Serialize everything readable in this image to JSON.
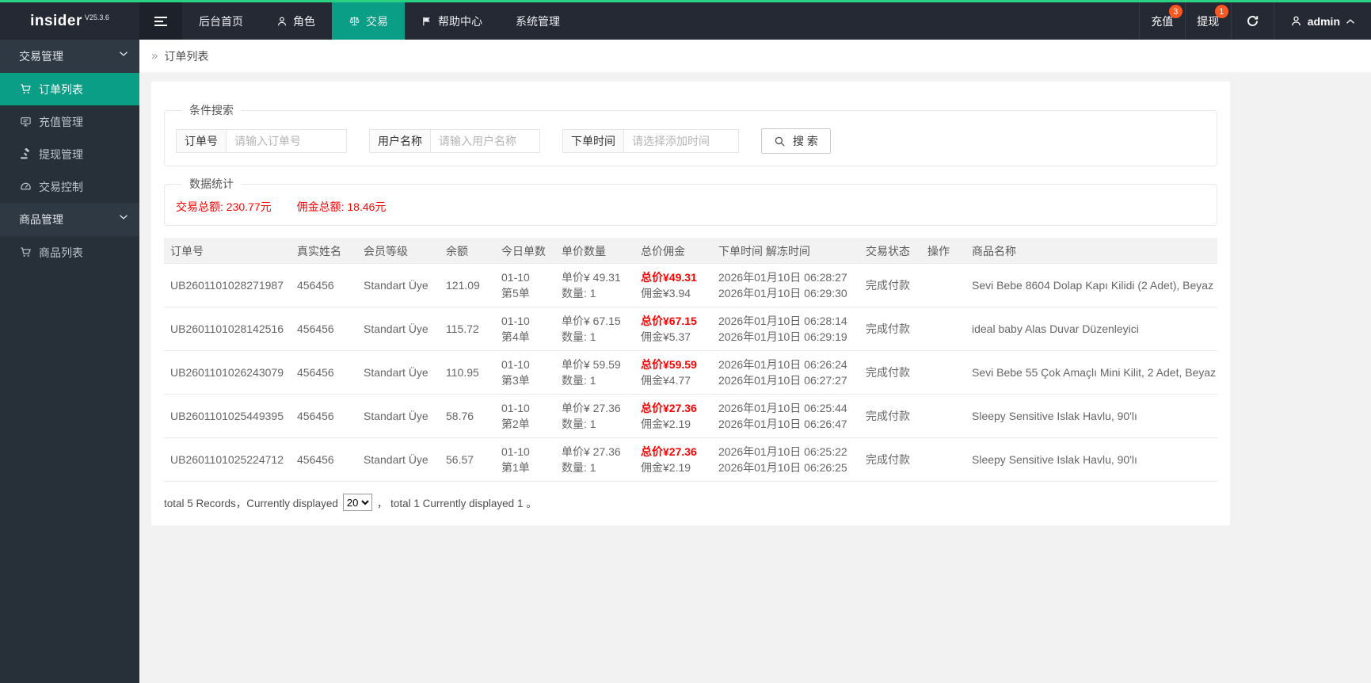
{
  "colors": {
    "accent_green": "#2ad184",
    "teal": "#0a9e86",
    "badge": "#ff5722",
    "red": "#ff0000"
  },
  "header": {
    "logo": "insider",
    "version": "V25.3.6",
    "nav": [
      {
        "label": "后台首页",
        "icon": "",
        "active": false
      },
      {
        "label": "角色",
        "icon": "user-icon",
        "active": false
      },
      {
        "label": "交易",
        "icon": "scales-icon",
        "active": true
      },
      {
        "label": "帮助中心",
        "icon": "flag-icon",
        "active": false
      },
      {
        "label": "系统管理",
        "icon": "",
        "active": false
      }
    ],
    "shortcuts": [
      {
        "label": "充值",
        "badge": "3"
      },
      {
        "label": "提现",
        "badge": "1"
      }
    ],
    "username": "admin"
  },
  "sidebar": {
    "items": [
      {
        "type": "group",
        "label": "交易管理"
      },
      {
        "type": "item",
        "label": "订单列表",
        "icon": "cart-icon",
        "active": true
      },
      {
        "type": "item",
        "label": "充值管理",
        "icon": "card-icon",
        "active": false
      },
      {
        "type": "item",
        "label": "提现管理",
        "icon": "gavel-icon",
        "active": false
      },
      {
        "type": "item",
        "label": "交易控制",
        "icon": "gauge-icon",
        "active": false
      },
      {
        "type": "group",
        "label": "商品管理"
      },
      {
        "type": "item",
        "label": "商品列表",
        "icon": "cart-icon",
        "active": false
      }
    ]
  },
  "breadcrumb": {
    "arrow": "»",
    "label": "订单列表"
  },
  "search_panel": {
    "legend": "条件搜索",
    "fields": [
      {
        "label": "订单号",
        "placeholder": "请输入订单号"
      },
      {
        "label": "用户名称",
        "placeholder": "请输入用户名称"
      },
      {
        "label": "下单时间",
        "placeholder": "请选择添加时间"
      }
    ],
    "search_button": "搜 索"
  },
  "stats_panel": {
    "legend": "数据统计",
    "items": [
      "交易总额: 230.77元",
      "佣金总额: 18.46元"
    ]
  },
  "table": {
    "columns": [
      "订单号",
      "真实姓名",
      "会员等级",
      "余额",
      "今日单数",
      "单价数量",
      "总价佣金",
      "下单时间 解冻时间",
      "交易状态",
      "操作",
      "商品名称"
    ],
    "rows": [
      {
        "order_no": "UB2601101028271987",
        "real_name": "456456",
        "level": "Standart Üye",
        "balance": "121.09",
        "date": "01-10",
        "daily": "第5单",
        "unit_price": "单价¥ 49.31",
        "quantity": "数量: 1",
        "total": "总价¥49.31",
        "commission": "佣金¥3.94",
        "order_time": "2026年01月10日 06:28:27",
        "unfreeze_time": "2026年01月10日 06:29:30",
        "status": "完成付款",
        "action": "",
        "product": "Sevi Bebe 8604 Dolap Kapı Kilidi (2 Adet), Beyaz"
      },
      {
        "order_no": "UB2601101028142516",
        "real_name": "456456",
        "level": "Standart Üye",
        "balance": "115.72",
        "date": "01-10",
        "daily": "第4单",
        "unit_price": "单价¥ 67.15",
        "quantity": "数量: 1",
        "total": "总价¥67.15",
        "commission": "佣金¥5.37",
        "order_time": "2026年01月10日 06:28:14",
        "unfreeze_time": "2026年01月10日 06:29:19",
        "status": "完成付款",
        "action": "",
        "product": "ideal baby Alas Duvar Düzenleyici"
      },
      {
        "order_no": "UB2601101026243079",
        "real_name": "456456",
        "level": "Standart Üye",
        "balance": "110.95",
        "date": "01-10",
        "daily": "第3单",
        "unit_price": "单价¥ 59.59",
        "quantity": "数量: 1",
        "total": "总价¥59.59",
        "commission": "佣金¥4.77",
        "order_time": "2026年01月10日 06:26:24",
        "unfreeze_time": "2026年01月10日 06:27:27",
        "status": "完成付款",
        "action": "",
        "product": "Sevi Bebe 55 Çok Amaçlı Mini Kilit, 2 Adet, Beyaz"
      },
      {
        "order_no": "UB2601101025449395",
        "real_name": "456456",
        "level": "Standart Üye",
        "balance": "58.76",
        "date": "01-10",
        "daily": "第2单",
        "unit_price": "单价¥ 27.36",
        "quantity": "数量: 1",
        "total": "总价¥27.36",
        "commission": "佣金¥2.19",
        "order_time": "2026年01月10日 06:25:44",
        "unfreeze_time": "2026年01月10日 06:26:47",
        "status": "完成付款",
        "action": "",
        "product": "Sleepy Sensitive Islak Havlu, 90'lı"
      },
      {
        "order_no": "UB2601101025224712",
        "real_name": "456456",
        "level": "Standart Üye",
        "balance": "56.57",
        "date": "01-10",
        "daily": "第1单",
        "unit_price": "单价¥ 27.36",
        "quantity": "数量: 1",
        "total": "总价¥27.36",
        "commission": "佣金¥2.19",
        "order_time": "2026年01月10日 06:25:22",
        "unfreeze_time": "2026年01月10日 06:26:25",
        "status": "完成付款",
        "action": "",
        "product": "Sleepy Sensitive Islak Havlu, 90'lı"
      }
    ]
  },
  "pagination": {
    "before_select": "total 5 Records，Currently displayed",
    "page_size": "20",
    "after_select": "， total 1 Currently displayed 1 。"
  }
}
